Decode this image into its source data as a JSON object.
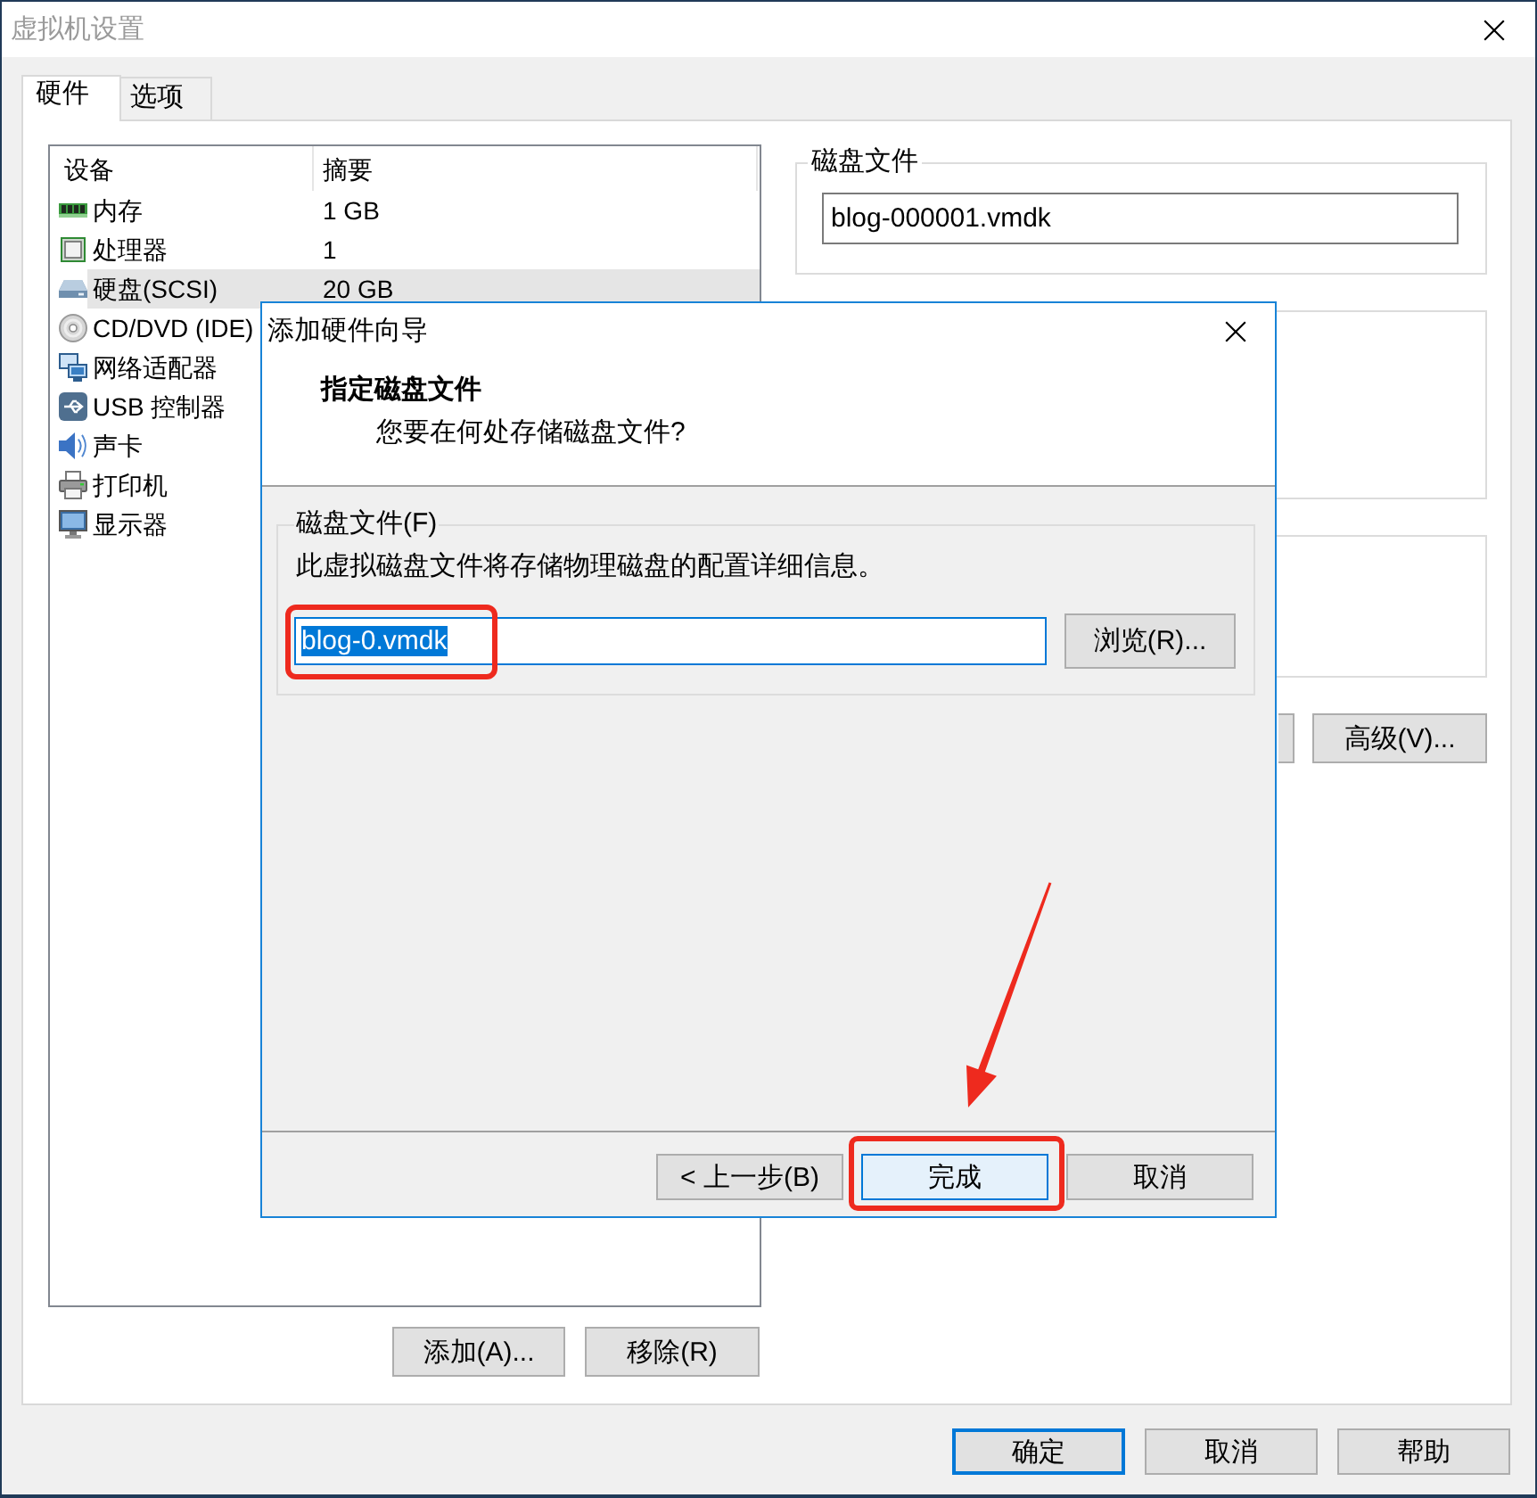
{
  "window": {
    "title": "虚拟机设置"
  },
  "tabs": [
    {
      "label": "硬件",
      "selected": true
    },
    {
      "label": "选项",
      "selected": false
    }
  ],
  "device_list": {
    "columns": [
      "设备",
      "摘要"
    ],
    "rows": [
      {
        "kind": "memory",
        "device": "内存",
        "summary": "1 GB",
        "selected": false
      },
      {
        "kind": "processor",
        "device": "处理器",
        "summary": "1",
        "selected": false
      },
      {
        "kind": "hard_disk",
        "device": "硬盘(SCSI)",
        "summary": "20 GB",
        "selected": true
      },
      {
        "kind": "cd_dvd",
        "device": "CD/DVD (IDE)",
        "selected": false
      },
      {
        "kind": "network",
        "device": "网络适配器",
        "selected": false
      },
      {
        "kind": "usb",
        "device": "USB 控制器",
        "selected": false
      },
      {
        "kind": "sound",
        "device": "声卡",
        "selected": false
      },
      {
        "kind": "printer",
        "device": "打印机",
        "selected": false
      },
      {
        "kind": "display",
        "device": "显示器",
        "selected": false
      }
    ]
  },
  "device_buttons": [
    {
      "label": "添加(A)..."
    },
    {
      "label": "移除(R)"
    }
  ],
  "disk_file": {
    "title": "磁盘文件",
    "value": "blog-000001.vmdk"
  },
  "side_buttons": [
    {
      "label": "高级(V)..."
    }
  ],
  "dialog": {
    "title": "添加硬件向导",
    "heading": "指定磁盘文件",
    "subheading": "您要在何处存储磁盘文件?",
    "group": {
      "title": "磁盘文件(F)",
      "description": "此虚拟磁盘文件将存储物理磁盘的配置详细信息。",
      "field": {
        "value": "blog-0.vmdk",
        "focused": true,
        "text_selected": true,
        "circled": true
      },
      "browse_button": "浏览(R)..."
    },
    "buttons": [
      {
        "label": "< 上一步(B)",
        "default": false,
        "focused": false,
        "circled": false,
        "arrow": false
      },
      {
        "label": "完成",
        "default": true,
        "focused": true,
        "circled": true,
        "arrow": true
      },
      {
        "label": "取消",
        "default": false,
        "focused": false,
        "circled": false,
        "arrow": false
      }
    ]
  },
  "buttons": [
    {
      "label": "确定",
      "default": true
    },
    {
      "label": "取消",
      "default": false
    },
    {
      "label": "帮助",
      "default": false
    }
  ]
}
